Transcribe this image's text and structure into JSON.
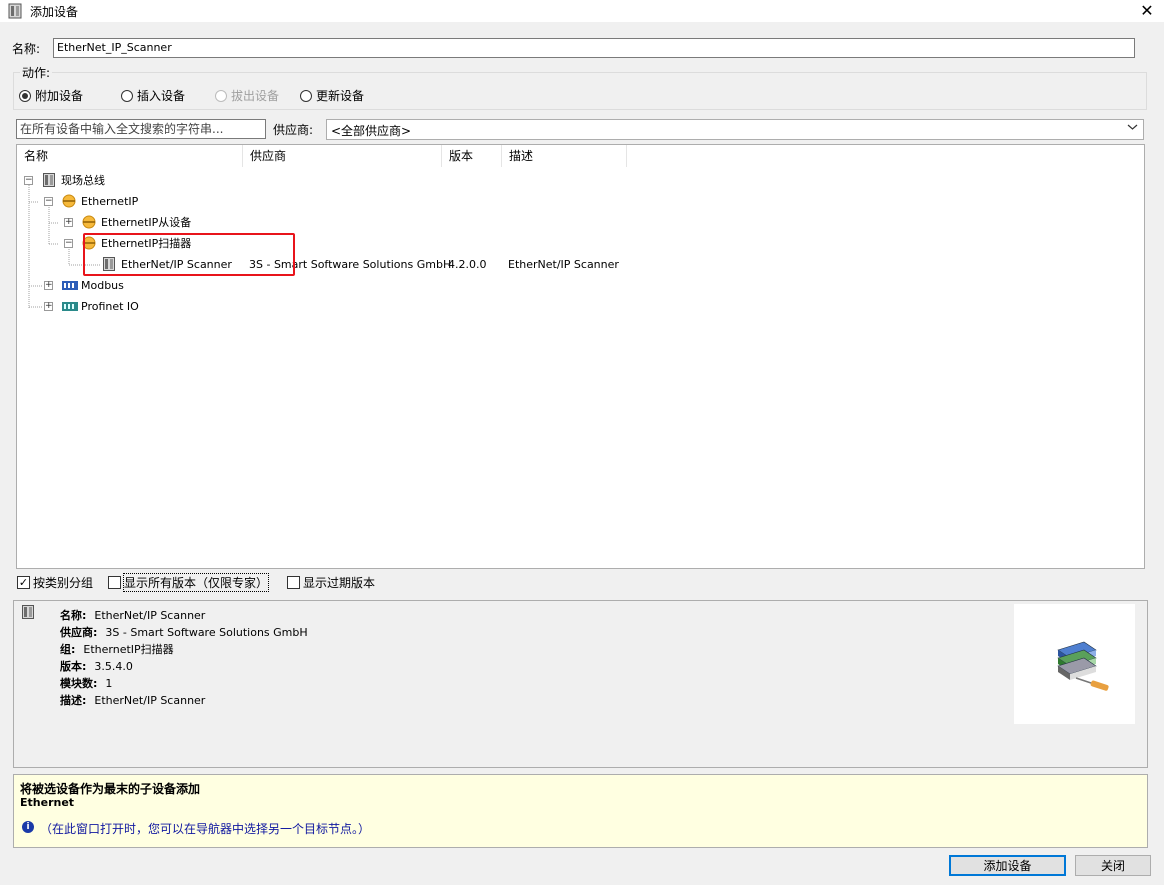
{
  "window": {
    "title": "添加设备",
    "close_glyph": "✕"
  },
  "name_row": {
    "label": "名称:",
    "value": "EtherNet_IP_Scanner"
  },
  "action": {
    "legend": "动作:",
    "options": [
      {
        "label": "附加设备",
        "checked": true,
        "disabled": false
      },
      {
        "label": "插入设备",
        "checked": false,
        "disabled": false
      },
      {
        "label": "拔出设备",
        "checked": false,
        "disabled": true
      },
      {
        "label": "更新设备",
        "checked": false,
        "disabled": false
      }
    ]
  },
  "search": {
    "placeholder": "在所有设备中输入全文搜索的字符串...",
    "vendor_label": "供应商:",
    "vendor_value": "<全部供应商>"
  },
  "table": {
    "columns": [
      "名称",
      "供应商",
      "版本",
      "描述"
    ],
    "rows": [
      {
        "name": "现场总线",
        "icon": "fieldbus-icon",
        "expander": "−"
      },
      {
        "name": "EthernetIP",
        "icon": "ethernetip-icon",
        "expander": "−"
      },
      {
        "name": "EthernetIP从设备",
        "icon": "ethernetip-icon",
        "expander": "+"
      },
      {
        "name": "EthernetIP扫描器",
        "icon": "ethernetip-icon",
        "expander": "−"
      },
      {
        "name": "EtherNet/IP Scanner",
        "icon": "device-icon",
        "vendor": "3S - Smart Software Solutions GmbH",
        "version": "4.2.0.0",
        "description": "EtherNet/IP Scanner"
      },
      {
        "name": "Modbus",
        "icon": "modbus-icon",
        "expander": "+"
      },
      {
        "name": "Profinet IO",
        "icon": "profinet-icon",
        "expander": "+"
      }
    ]
  },
  "options": {
    "group_by_category": {
      "label": "按类别分组",
      "checked": true
    },
    "show_all_versions": {
      "label": "显示所有版本（仅限专家）",
      "checked": false
    },
    "show_outdated": {
      "label": "显示过期版本",
      "checked": false
    }
  },
  "info": {
    "name_label": "名称:",
    "name_value": "EtherNet/IP Scanner",
    "vendor_label": "供应商:",
    "vendor_value": "3S - Smart Software Solutions GmbH",
    "group_label": "组:",
    "group_value": "EthernetIP扫描器",
    "version_label": "版本:",
    "version_value": "3.5.4.0",
    "module_label": "模块数:",
    "module_value": "1",
    "desc_label": "描述:",
    "desc_value": "EtherNet/IP Scanner"
  },
  "message": {
    "line1": "将被选设备作为最末的子设备添加",
    "line2": "Ethernet",
    "hint": "（在此窗口打开时，您可以在导航器中选择另一个目标节点。）"
  },
  "buttons": {
    "add": "添加设备",
    "close": "关闭"
  },
  "colors": {
    "highlight": "#e8141b",
    "message_bg": "#ffffe1",
    "accent": "#0078d7"
  }
}
